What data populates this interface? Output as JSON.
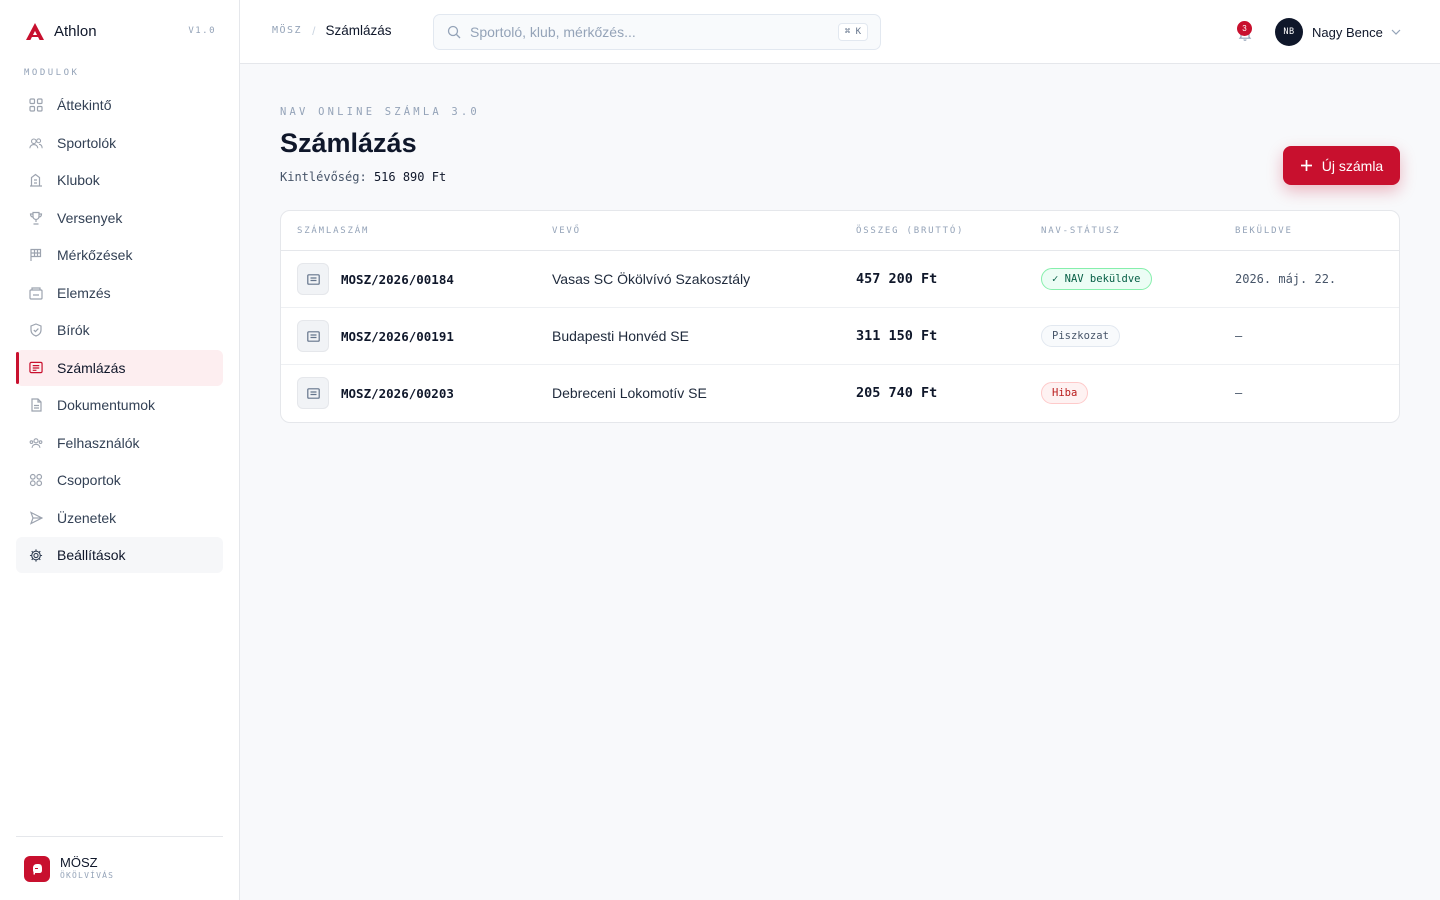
{
  "app": {
    "name": "Athlon",
    "version": "V1.0"
  },
  "sidebar": {
    "section_label": "MODULOK",
    "items": [
      {
        "label": "Áttekintő",
        "icon": "grid-icon"
      },
      {
        "label": "Sportolók",
        "icon": "users-icon"
      },
      {
        "label": "Klubok",
        "icon": "building-icon"
      },
      {
        "label": "Versenyek",
        "icon": "trophy-icon"
      },
      {
        "label": "Mérkőzések",
        "icon": "flag-icon"
      },
      {
        "label": "Elemzés",
        "icon": "chart-icon"
      },
      {
        "label": "Bírók",
        "icon": "shield-icon"
      },
      {
        "label": "Számlázás",
        "icon": "invoice-icon",
        "active": true
      },
      {
        "label": "Dokumentumok",
        "icon": "document-icon"
      },
      {
        "label": "Felhasználók",
        "icon": "people-icon"
      },
      {
        "label": "Csoportok",
        "icon": "groups-icon"
      },
      {
        "label": "Üzenetek",
        "icon": "send-icon"
      },
      {
        "label": "Beállítások",
        "icon": "gear-icon"
      }
    ],
    "org": {
      "name": "MÖSZ",
      "subtitle": "ÖKÖLVÍVÁS"
    }
  },
  "topbar": {
    "breadcrumb_root": "MÖSZ",
    "breadcrumb_separator": "/",
    "breadcrumb_current": "Számlázás",
    "search_placeholder": "Sportoló, klub, mérkőzés...",
    "search_shortcut": "⌘ K",
    "notification_count": "3",
    "user_initials": "NB",
    "user_name": "Nagy Bence"
  },
  "page": {
    "eyebrow": "NAV ONLINE SZÁMLA 3.0",
    "title": "Számlázás",
    "outstanding_label": "Kintlévőség:",
    "outstanding_value": "516 890 Ft",
    "new_button_label": "Új számla"
  },
  "table": {
    "headers": [
      "SZÁMLASZÁM",
      "VEVŐ",
      "ÖSSZEG (BRUTTÓ)",
      "NAV-STÁTUSZ",
      "BEKÜLDVE"
    ],
    "rows": [
      {
        "number": "MOSZ/2026/00184",
        "buyer": "Vasas SC Ökölvívó Szakosztály",
        "amount": "457 200 Ft",
        "status": "✓ NAV beküldve",
        "status_kind": "ok",
        "sent": "2026. máj. 22."
      },
      {
        "number": "MOSZ/2026/00191",
        "buyer": "Budapesti Honvéd SE",
        "amount": "311 150 Ft",
        "status": "Piszkozat",
        "status_kind": "draft",
        "sent": "—"
      },
      {
        "number": "MOSZ/2026/00203",
        "buyer": "Debreceni Lokomotív SE",
        "amount": "205 740 Ft",
        "status": "Hiba",
        "status_kind": "err",
        "sent": "—"
      }
    ]
  },
  "colors": {
    "accent": "#c8102e",
    "text": "#0f172a",
    "muted": "#94a3b8"
  }
}
